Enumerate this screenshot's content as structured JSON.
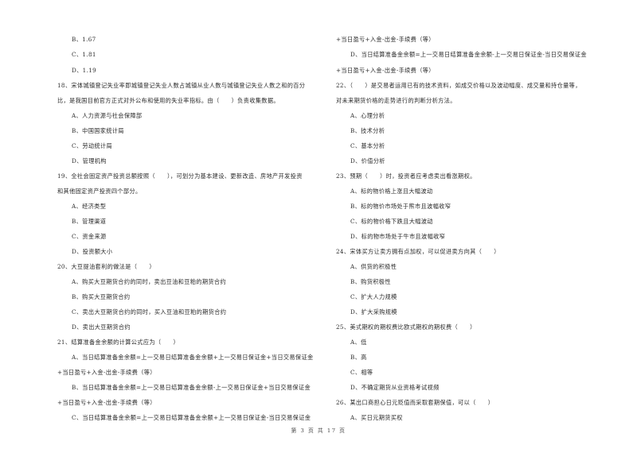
{
  "page": {
    "footer": "第 3 页 共 17 页"
  },
  "left_column": {
    "prev_options": [
      "B、1.67",
      "C、1.81",
      "D、1.19"
    ],
    "q18": {
      "stem_line1": "18、宋体城镇登记失业率即城镇登记失业人数占城镇从业人数与城镇登记失业人数之和的百分",
      "stem_line2": "比，是我国目前官方正式对外公布和使用的失业率指标。由（　　）负责收集数据。",
      "options": [
        "A、人力资源与社会保障部",
        "B、中国国家统计局",
        "C、劳动统计局",
        "D、管理机构"
      ]
    },
    "q19": {
      "stem_line1": "19、全社会固定资产投资总额按照（　　），可划分为基本建设、更新改造、房地产开发投资",
      "stem_line2": "和其他固定资产投资四个部分。",
      "options": [
        "A、经济类型",
        "B、管理渠道",
        "C、资金来源",
        "D、投资额大小"
      ]
    },
    "q20": {
      "stem": "20、大豆提油套利的做法是（　　）",
      "options": [
        "A、购买大豆期货合约的同时，卖出豆油和豆粕的期货合约",
        "B、购买大豆期货合约",
        "C、卖出大豆期货合约的同时，买入豆油和豆粕的期货合约",
        "D、卖出大豆期货合约"
      ]
    },
    "q21": {
      "stem": "21、结算准备金余额的计算公式应为（　　）",
      "option_a_line1": "A、当日结算准备金余额=上一交易日结算准备金余额+上一交易日保证金+当日交易保证金",
      "option_a_line2": "+当日盈亏+入金-出金-手续费（等）",
      "option_b_line1": "B、当日结算准备金余额=上一交易日结算准备金余额-上一交易日保证金+当日交易保证金",
      "option_b_line2": "+当日盈亏+入金-出金-手续费（等）",
      "option_c_line1": "C、当日结算准备金余额=上一交易日结算准备金余额+上一交易日保证金-当日交易保证金"
    }
  },
  "right_column": {
    "q21_cont": {
      "option_c_line2": "+当日盈亏+入金-出金-手续费（等）",
      "option_d_line1": "D、当日结算准备金余额=上一交易日结算准备金余额-上一交易日保证金-当日交易保证金",
      "option_d_line2": "+当日盈亏+入金-出金-手续费（等）"
    },
    "q22": {
      "stem_line1": "22、（　　）是交易者运用已有的技术资料，如成交价格以及波动幅度、成交量和持仓量等，",
      "stem_line2": "对未来期货价格的走势进行的判断分析方法。",
      "options": [
        "A、心理分析",
        "B、技术分析",
        "C、基本分析",
        "D、价值分析"
      ]
    },
    "q23": {
      "stem": "23、预期（　　）时，投资者应考虑卖出看涨期权。",
      "options": [
        "A、标的物价格上涨且大幅波动",
        "B、标的物价市场处于熊市且波幅收窄",
        "C、标的物价格下跌且大幅波动",
        "D、标的物市场处于牛市且波幅收窄"
      ]
    },
    "q24": {
      "stem": "24、宋体买方让卖方拥有点加权，可以促进卖方向其（　　）",
      "options": [
        "A、供货的积极性",
        "B、购货积极性",
        "C、扩大人力规模",
        "D、扩大采购规模"
      ]
    },
    "q25": {
      "stem": "25、美式期权的期权费比欧式期权的期权费（　　）",
      "options": [
        "A、低",
        "B、高",
        "C、相等",
        "D、不确定期货从业资格考试视频"
      ]
    },
    "q26": {
      "stem": "26、某出口商担心日元贬值而采取套期保值，可以（　　）",
      "options": [
        "A、买日元期货买权"
      ]
    }
  }
}
